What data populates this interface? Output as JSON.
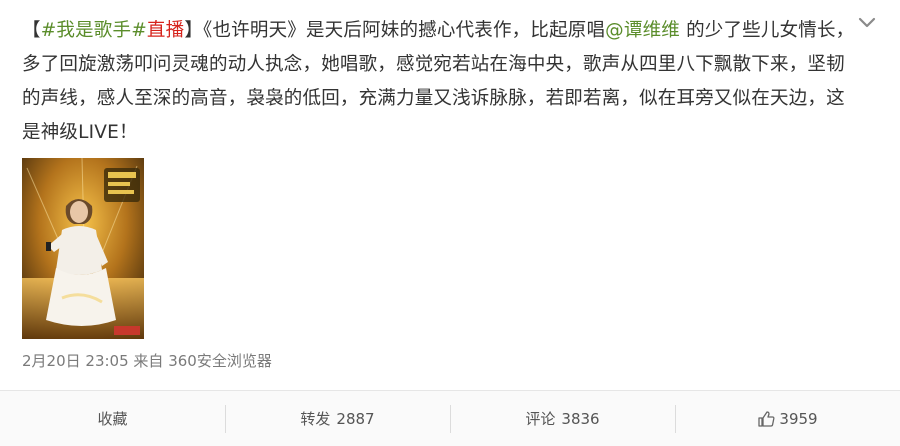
{
  "post": {
    "bracket_open": "【",
    "topic_1": "#我是歌手#",
    "topic_2": "直播",
    "bracket_close": "】",
    "text_1": "《也许明天》是天后阿妹的撼心代表作，比起原唱",
    "mention": "@谭维维",
    "text_2": " 的少了些儿女情长，多了回旋激荡叩问灵魂的动人执念，她唱歌，感觉宛若站在海中央，歌声从四里八下飘散下来，坚韧的声线，感人至深的高音，袅袅的低回，充满力量又浅诉脉脉，若即若离，似在耳旁又似在天边，这是神级LIVE！",
    "time": "2月20日 23:05",
    "source_prefix": "来自",
    "source": "360安全浏览器"
  },
  "actions": {
    "favorite_label": "收藏",
    "repost_label": "转发",
    "repost_count": "2887",
    "comment_label": "评论",
    "comment_count": "3836",
    "like_count": "3959"
  },
  "icons": {
    "chevron": "chevron-down-icon",
    "like": "thumbs-up-icon"
  },
  "colors": {
    "topic": "#5b8d2b",
    "tag_red": "#d6231c",
    "meta": "#7a7a7a"
  }
}
